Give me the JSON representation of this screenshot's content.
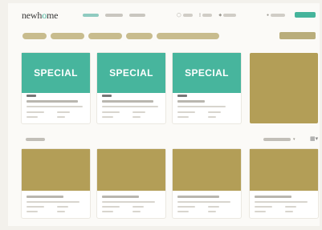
{
  "header": {
    "logo_prefix": "newh",
    "logo_o": "o",
    "logo_suffix": "me",
    "icons": [
      "search-icon",
      "favorites-icon",
      "notifications-icon",
      "user-icon"
    ]
  },
  "cards_row1": [
    {
      "image_text": "SPECIAL"
    },
    {
      "image_text": "SPECIAL"
    },
    {
      "image_text": "SPECIAL"
    },
    {
      "image_text": ""
    }
  ],
  "colors": {
    "accent": "#45b49b",
    "special_bg": "#47b59d",
    "photo_placeholder": "#b39e57",
    "filter_pill": "#c8bc8e"
  }
}
